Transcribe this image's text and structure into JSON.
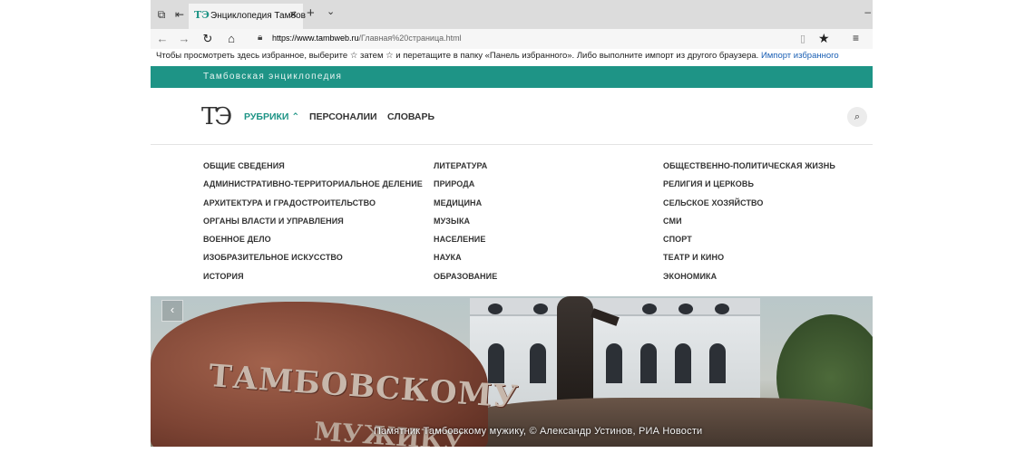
{
  "browser": {
    "tab": {
      "favicon": "ТЭ",
      "title": "Энциклопедия Тамбов",
      "close": "✕"
    },
    "new_tab": "+",
    "tab_menu": "⌄",
    "minimize": "–",
    "nav": {
      "back": "←",
      "forward": "→",
      "refresh": "↻",
      "home": "⌂"
    },
    "url_domain": "https://www.tambweb.ru",
    "url_path": "/Главная%20страница.html",
    "icons": {
      "reader": "▯",
      "favorite": "★",
      "hub": "≡"
    }
  },
  "favorites_bar": {
    "text_before": "Чтобы просмотреть здесь избранное, выберите  ☆  затем ☆ и перетащите в папку «Панель избранного». Либо выполните импорт из другого браузера.",
    "link": "Импорт избранного"
  },
  "site": {
    "bar_title": "Тамбовская энциклопедия",
    "logo": "ТЭ",
    "nav": {
      "rubrics": "РУБРИКИ ⌃",
      "persons": "ПЕРСОНАЛИИ",
      "dictionary": "СЛОВАРЬ"
    },
    "search_icon": "⌕"
  },
  "rubrics": {
    "col1": [
      "ОБЩИЕ СВЕДЕНИЯ",
      "АДМИНИСТРАТИВНО-ТЕРРИТОРИАЛЬНОЕ ДЕЛЕНИЕ",
      "АРХИТЕКТУРА И ГРАДОСТРОИТЕЛЬСТВО",
      "ОРГАНЫ ВЛАСТИ И УПРАВЛЕНИЯ",
      "ВОЕННОЕ ДЕЛО",
      "ИЗОБРАЗИТЕЛЬНОЕ ИСКУССТВО",
      "ИСТОРИЯ"
    ],
    "col2": [
      "ЛИТЕРАТУРА",
      "ПРИРОДА",
      "МЕДИЦИНА",
      "МУЗЫКА",
      "НАСЕЛЕНИЕ",
      "НАУКА",
      "ОБРАЗОВАНИЕ"
    ],
    "col3": [
      "ОБЩЕСТВЕННО-ПОЛИТИЧЕСКАЯ ЖИЗНЬ",
      "РЕЛИГИЯ И ЦЕРКОВЬ",
      "СЕЛЬСКОЕ ХОЗЯЙСТВО",
      "СМИ",
      "СПОРТ",
      "ТЕАТР И КИНО",
      "ЭКОНОМИКА"
    ]
  },
  "hero": {
    "prev": "‹",
    "stone_text": "ТАМБОВСКОМУ",
    "stone_text2": "МУЖИКУ",
    "caption": "Памятник Тамбовскому мужику, © Александр Устинов, РИА Новости"
  }
}
